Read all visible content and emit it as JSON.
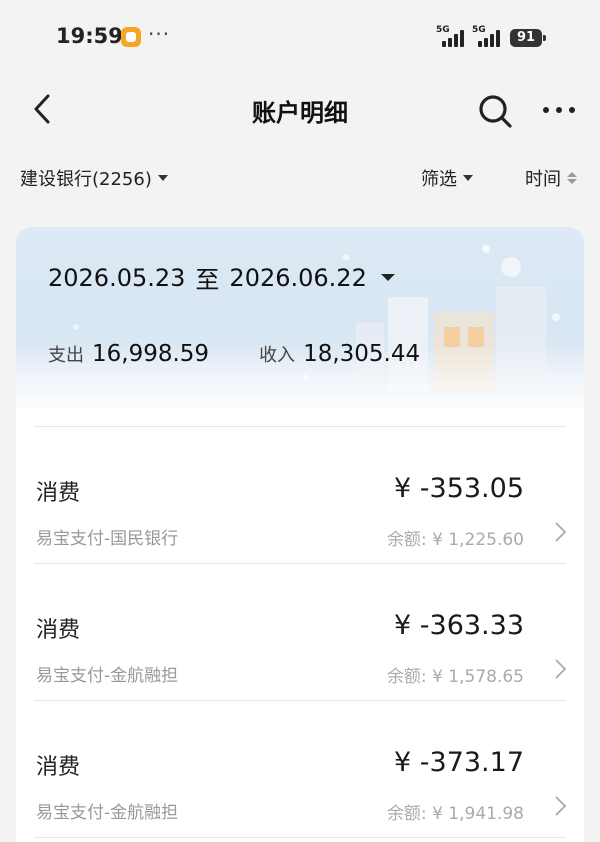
{
  "status_bar": {
    "time": "19:59",
    "more": "···",
    "signal1": "5G",
    "signal2": "5G",
    "battery": "91"
  },
  "header": {
    "title": "账户明细",
    "back_icon": "back-arrow-icon",
    "search_icon": "search-icon",
    "more_icon": "more-icon"
  },
  "filters": {
    "account": "建设银行(2256)",
    "filter": "筛选",
    "sort": "时间"
  },
  "summary": {
    "date_from": "2026.05.23",
    "date_sep": "至",
    "date_to": "2026.06.22",
    "expense_label": "支出",
    "expense_value": "16,998.59",
    "income_label": "收入",
    "income_value": "18,305.44"
  },
  "transactions": [
    {
      "type": "消费",
      "merchant": "易宝支付-国民银行",
      "amount": "¥ -353.05",
      "balance": "余额: ¥ 1,225.60"
    },
    {
      "type": "消费",
      "merchant": "易宝支付-金航融担",
      "amount": "¥ -363.33",
      "balance": "余额: ¥ 1,578.65"
    },
    {
      "type": "消费",
      "merchant": "易宝支付-金航融担",
      "amount": "¥ -373.17",
      "balance": "余额: ¥ 1,941.98"
    }
  ]
}
